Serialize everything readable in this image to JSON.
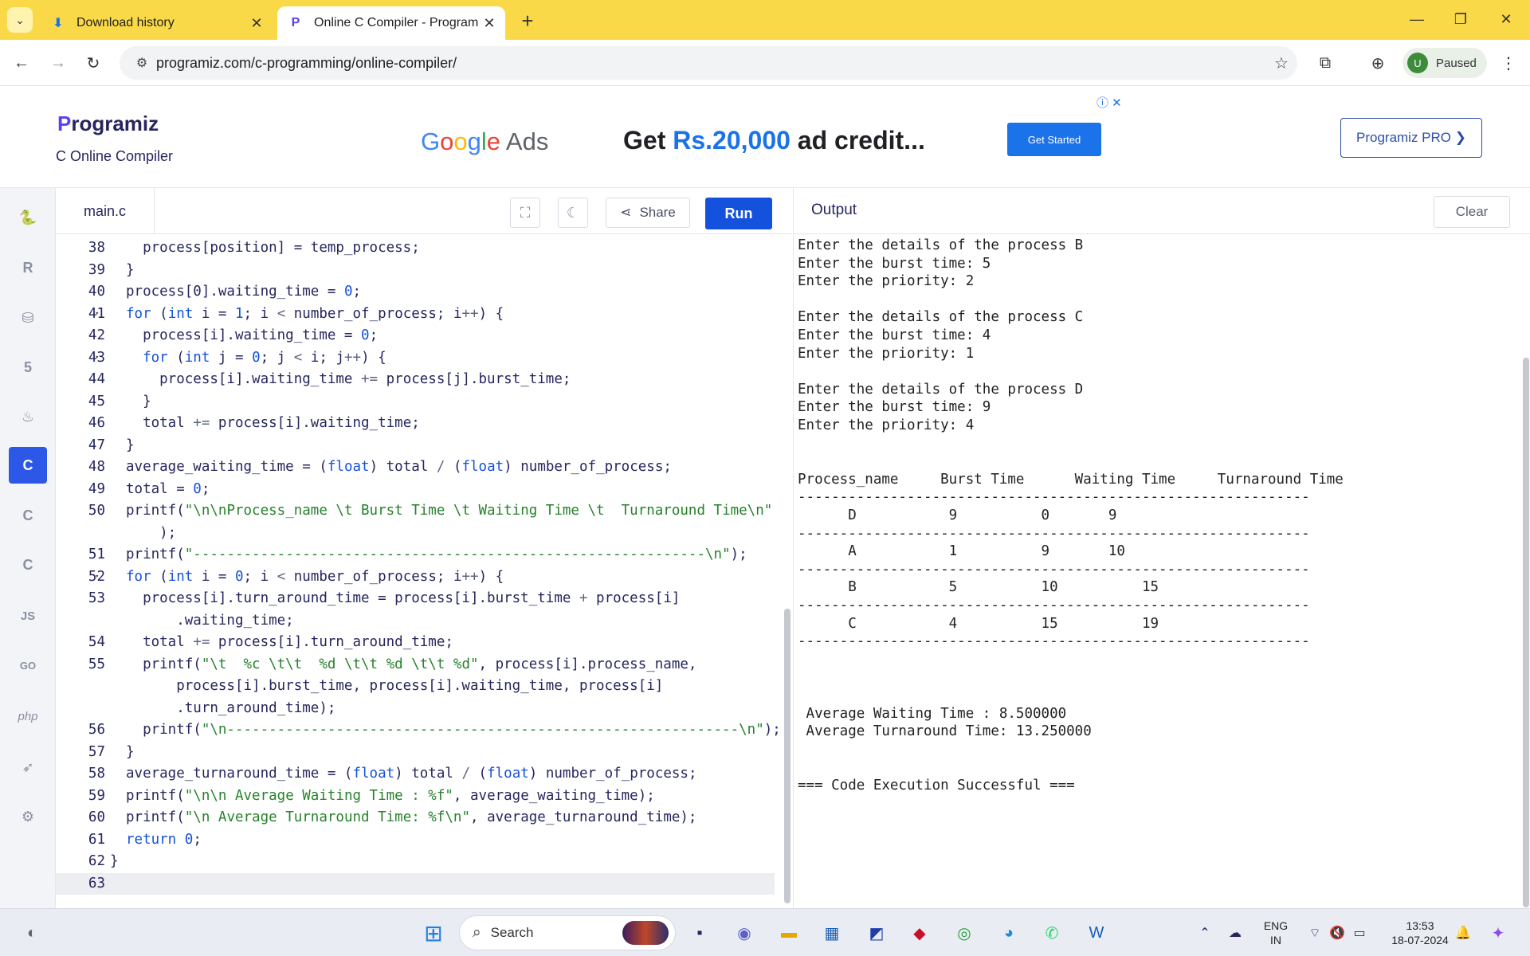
{
  "browser": {
    "tabs": [
      {
        "title": "Download history",
        "icon": "download-icon"
      },
      {
        "title": "Online C Compiler - Programiz",
        "icon": "programiz-favicon"
      }
    ],
    "url": "programiz.com/c-programming/online-compiler/",
    "profile": {
      "initial": "U",
      "status": "Paused"
    }
  },
  "site": {
    "logo": "rogramiz",
    "logo_p": "P",
    "subtitle": "C Online Compiler",
    "pro_button": "Programiz PRO ❯"
  },
  "ad": {
    "brand_G": "G",
    "brand_o1": "o",
    "brand_o2": "o",
    "brand_g": "g",
    "brand_l": "l",
    "brand_e": "e",
    "brand_rest": " Ads",
    "headline_pre": "Get ",
    "headline_amount": "Rs.20,000",
    "headline_post": " ad credit...",
    "cta": "Get Started"
  },
  "editor": {
    "file_name": "main.c",
    "share_label": "Share",
    "run_label": "Run",
    "lines": [
      {
        "n": "38",
        "fold": "",
        "html": "  process[position] = temp_process;"
      },
      {
        "n": "39",
        "fold": "",
        "html": "}"
      },
      {
        "n": "40",
        "fold": "",
        "html": "process[0].waiting_time = <span class=\"kw\">0</span>;"
      },
      {
        "n": "41",
        "fold": "▾",
        "html": "<span class=\"kw\">for</span> (<span class=\"kw\">int</span> i = <span class=\"kw\">1</span>; i <span class=\"op\">&lt;</span> number_of_process; i<span class=\"op\">++</span>) {"
      },
      {
        "n": "42",
        "fold": "",
        "html": "  process[i].waiting_time = <span class=\"kw\">0</span>;"
      },
      {
        "n": "43",
        "fold": "▾",
        "html": "  <span class=\"kw\">for</span> (<span class=\"kw\">int</span> j = <span class=\"kw\">0</span>; j <span class=\"op\">&lt;</span> i; j<span class=\"op\">++</span>) {"
      },
      {
        "n": "44",
        "fold": "",
        "html": "    process[i].waiting_time <span class=\"op\">+=</span> process[j].burst_time;"
      },
      {
        "n": "45",
        "fold": "",
        "html": "  }"
      },
      {
        "n": "46",
        "fold": "",
        "html": "  total <span class=\"op\">+=</span> process[i].waiting_time;"
      },
      {
        "n": "47",
        "fold": "",
        "html": "}"
      },
      {
        "n": "48",
        "fold": "",
        "html": "average_waiting_time = (<span class=\"kw\">float</span>) total <span class=\"op\">/</span> (<span class=\"kw\">float</span>) number_of_process;"
      },
      {
        "n": "49",
        "fold": "",
        "html": "total = <span class=\"kw\">0</span>;"
      },
      {
        "n": "50",
        "fold": "",
        "html": "printf(<span class=\"str\">\"\\n\\nProcess_name \\t Burst Time \\t Waiting Time \\t  Turnaround Time\\n\"</span>"
      },
      {
        "n": "",
        "fold": "",
        "html": "    );"
      },
      {
        "n": "51",
        "fold": "",
        "html": "printf(<span class=\"str\">\"-------------------------------------------------------------\\n\"</span>);"
      },
      {
        "n": "52",
        "fold": "▾",
        "html": "<span class=\"kw\">for</span> (<span class=\"kw\">int</span> i = <span class=\"kw\">0</span>; i <span class=\"op\">&lt;</span> number_of_process; i<span class=\"op\">++</span>) {"
      },
      {
        "n": "53",
        "fold": "",
        "html": "  process[i].turn_around_time = process[i].burst_time <span class=\"op\">+</span> process[i]"
      },
      {
        "n": "",
        "fold": "",
        "html": "      .waiting_time;"
      },
      {
        "n": "54",
        "fold": "",
        "html": "  total <span class=\"op\">+=</span> process[i].turn_around_time;"
      },
      {
        "n": "55",
        "fold": "",
        "html": "  printf(<span class=\"str\">\"\\t  %c \\t\\t  %d \\t\\t %d \\t\\t %d\"</span>, process[i].process_name,"
      },
      {
        "n": "",
        "fold": "",
        "html": "      process[i].burst_time, process[i].waiting_time, process[i]"
      },
      {
        "n": "",
        "fold": "",
        "html": "      .turn_around_time);"
      },
      {
        "n": "56",
        "fold": "",
        "html": "  printf(<span class=\"str\">\"\\n-------------------------------------------------------------\\n\"</span>);"
      },
      {
        "n": "57",
        "fold": "",
        "html": "}"
      },
      {
        "n": "58",
        "fold": "",
        "html": "average_turnaround_time = (<span class=\"kw\">float</span>) total <span class=\"op\">/</span> (<span class=\"kw\">float</span>) number_of_process;"
      },
      {
        "n": "59",
        "fold": "",
        "html": "printf(<span class=\"str\">\"\\n\\n Average Waiting Time : %f\"</span>, average_waiting_time);"
      },
      {
        "n": "60",
        "fold": "",
        "html": "printf(<span class=\"str\">\"\\n Average Turnaround Time: %f\\n\"</span>, average_turnaround_time);"
      },
      {
        "n": "61",
        "fold": "",
        "html": "<span class=\"kw\">return</span> <span class=\"kw\">0</span>;"
      },
      {
        "n": "62",
        "fold": "",
        "html": "}"
      },
      {
        "n": "63",
        "fold": "",
        "html": ""
      }
    ]
  },
  "output": {
    "title": "Output",
    "clear_label": "Clear",
    "lines": [
      "Enter the details of the process B",
      "Enter the burst time: 5",
      "Enter the priority: 2",
      "",
      "Enter the details of the process C",
      "Enter the burst time: 4",
      "Enter the priority: 1",
      "",
      "Enter the details of the process D",
      "Enter the burst time: 9",
      "Enter the priority: 4",
      "",
      "",
      "Process_name     Burst Time      Waiting Time     Turnaround Time",
      "-------------------------------------------------------------",
      "      D           9          0       9",
      "-------------------------------------------------------------",
      "      A           1          9       10",
      "-------------------------------------------------------------",
      "      B           5          10          15",
      "-------------------------------------------------------------",
      "      C           4          15          19",
      "-------------------------------------------------------------",
      "",
      "",
      "",
      " Average Waiting Time : 8.500000",
      " Average Turnaround Time: 13.250000",
      "",
      "",
      "=== Code Execution Successful ==="
    ]
  },
  "taskbar": {
    "search_placeholder": "Search",
    "lang_top": "ENG",
    "lang_bottom": "IN",
    "time": "13:53",
    "date": "18-07-2024"
  },
  "sidebar_langs": [
    "JS",
    "GO",
    "php"
  ]
}
